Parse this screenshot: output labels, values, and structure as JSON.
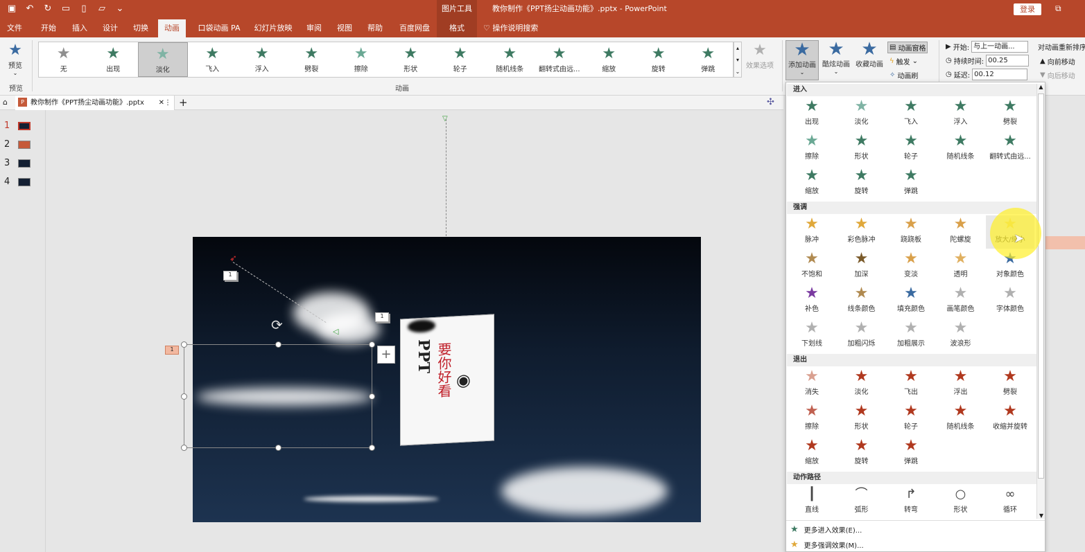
{
  "titlebar": {
    "qat_icons": [
      "save-icon",
      "undo-icon",
      "redo-icon",
      "present-icon",
      "new-icon",
      "open-icon",
      "more-icon"
    ],
    "context_label": "图片工具",
    "doc_title": "教你制作《PPT扬尘动画功能》.pptx - PowerPoint",
    "login": "登录"
  },
  "tabs": [
    "文件",
    "开始",
    "插入",
    "设计",
    "切换",
    "动画",
    "口袋动画 PA",
    "幻灯片放映",
    "审阅",
    "视图",
    "帮助",
    "百度网盘",
    "格式"
  ],
  "tellme": "操作说明搜索",
  "ribbon": {
    "preview_label": "预览",
    "preview_group": "预览",
    "gallery": [
      {
        "label": "无",
        "color": "#8f8f8f"
      },
      {
        "label": "出现",
        "color": "#3e7a62"
      },
      {
        "label": "淡化",
        "color": "#7fb3a4"
      },
      {
        "label": "飞入",
        "color": "#3e7a62"
      },
      {
        "label": "浮入",
        "color": "#3e7a62"
      },
      {
        "label": "劈裂",
        "color": "#3e7a62"
      },
      {
        "label": "擦除",
        "color": "#6aa894"
      },
      {
        "label": "形状",
        "color": "#3e7a62"
      },
      {
        "label": "轮子",
        "color": "#3e7a62"
      },
      {
        "label": "随机线条",
        "color": "#3e7a62"
      },
      {
        "label": "翻转式由远...",
        "color": "#3e7a62"
      },
      {
        "label": "缩放",
        "color": "#3e7a62"
      },
      {
        "label": "旋转",
        "color": "#3e7a62"
      },
      {
        "label": "弹跳",
        "color": "#3e7a62"
      }
    ],
    "group_animation": "动画",
    "effect_options": "效果选项",
    "add_animation": "添加动画",
    "cool_animation": "酷炫动画",
    "fav_animation": "收藏动画",
    "anim_pane": "动画窗格",
    "trigger": "触发",
    "anim_painter": "动画刷",
    "start_label": "开始:",
    "start_value": "与上一动画...",
    "duration_label": "持续时间:",
    "duration_value": "00.25",
    "delay_label": "延迟:",
    "delay_value": "00.12",
    "reorder": "对动画重新排序",
    "move_earlier": "向前移动",
    "move_later": "向后移动"
  },
  "doc_tab": "教你制作《PPT扬尘动画功能》.pptx",
  "slides": [
    "1",
    "2",
    "3",
    "4"
  ],
  "slide": {
    "badge1": "1",
    "badge2": "1",
    "badge3": "1",
    "book_title": "PPT",
    "book_sub": "要你好看"
  },
  "panel": {
    "entrance": "进入",
    "entrance_items": [
      {
        "label": "出现",
        "color": "#3e7a62"
      },
      {
        "label": "淡化",
        "color": "#7fb3a4"
      },
      {
        "label": "飞入",
        "color": "#3e7a62"
      },
      {
        "label": "浮入",
        "color": "#3e7a62"
      },
      {
        "label": "劈裂",
        "color": "#3e7a62"
      },
      {
        "label": "擦除",
        "color": "#6aa894"
      },
      {
        "label": "形状",
        "color": "#3e7a62"
      },
      {
        "label": "轮子",
        "color": "#3e7a62"
      },
      {
        "label": "随机线条",
        "color": "#3e7a62"
      },
      {
        "label": "翻转式由远...",
        "color": "#3e7a62"
      },
      {
        "label": "缩放",
        "color": "#3e7a62"
      },
      {
        "label": "旋转",
        "color": "#3e7a62"
      },
      {
        "label": "弹跳",
        "color": "#3e7a62"
      }
    ],
    "emphasis": "强调",
    "emphasis_items": [
      {
        "label": "脉冲",
        "color": "#e0a83a"
      },
      {
        "label": "彩色脉冲",
        "color": "#e0a83a"
      },
      {
        "label": "跷跷板",
        "color": "#d9a04a"
      },
      {
        "label": "陀螺旋",
        "color": "#d9a04a"
      },
      {
        "label": "放大/缩小",
        "color": "#e8d27a"
      },
      {
        "label": "不饱和",
        "color": "#b08a50"
      },
      {
        "label": "加深",
        "color": "#7a5a2a"
      },
      {
        "label": "变淡",
        "color": "#d9a04a"
      },
      {
        "label": "透明",
        "color": "#e0b060"
      },
      {
        "label": "对象颜色",
        "color": "#3a6aa0"
      },
      {
        "label": "补色",
        "color": "#7a3aa0"
      },
      {
        "label": "线条颜色",
        "color": "#b08a50"
      },
      {
        "label": "填充颜色",
        "color": "#3a6aa0"
      },
      {
        "label": "画笔颜色",
        "color": "#b0b0b0"
      },
      {
        "label": "字体颜色",
        "color": "#b0b0b0"
      },
      {
        "label": "下划线",
        "color": "#b0b0b0"
      },
      {
        "label": "加粗闪烁",
        "color": "#b0b0b0"
      },
      {
        "label": "加粗展示",
        "color": "#b0b0b0"
      },
      {
        "label": "波浪形",
        "color": "#b0b0b0"
      }
    ],
    "exit": "退出",
    "exit_items": [
      {
        "label": "消失",
        "color": "#d9a090"
      },
      {
        "label": "淡化",
        "color": "#b0381e"
      },
      {
        "label": "飞出",
        "color": "#b0381e"
      },
      {
        "label": "浮出",
        "color": "#b0381e"
      },
      {
        "label": "劈裂",
        "color": "#b0381e"
      },
      {
        "label": "擦除",
        "color": "#c06050"
      },
      {
        "label": "形状",
        "color": "#b0381e"
      },
      {
        "label": "轮子",
        "color": "#b0381e"
      },
      {
        "label": "随机线条",
        "color": "#b0381e"
      },
      {
        "label": "收缩并旋转",
        "color": "#b0381e"
      },
      {
        "label": "缩放",
        "color": "#b0381e"
      },
      {
        "label": "旋转",
        "color": "#b0381e"
      },
      {
        "label": "弹跳",
        "color": "#b0381e"
      }
    ],
    "path": "动作路径",
    "path_items": [
      {
        "label": "直线"
      },
      {
        "label": "弧形"
      },
      {
        "label": "转弯"
      },
      {
        "label": "形状"
      },
      {
        "label": "循环"
      }
    ],
    "more_entrance": "更多进入效果(E)...",
    "more_emphasis": "更多强调效果(M)..."
  }
}
